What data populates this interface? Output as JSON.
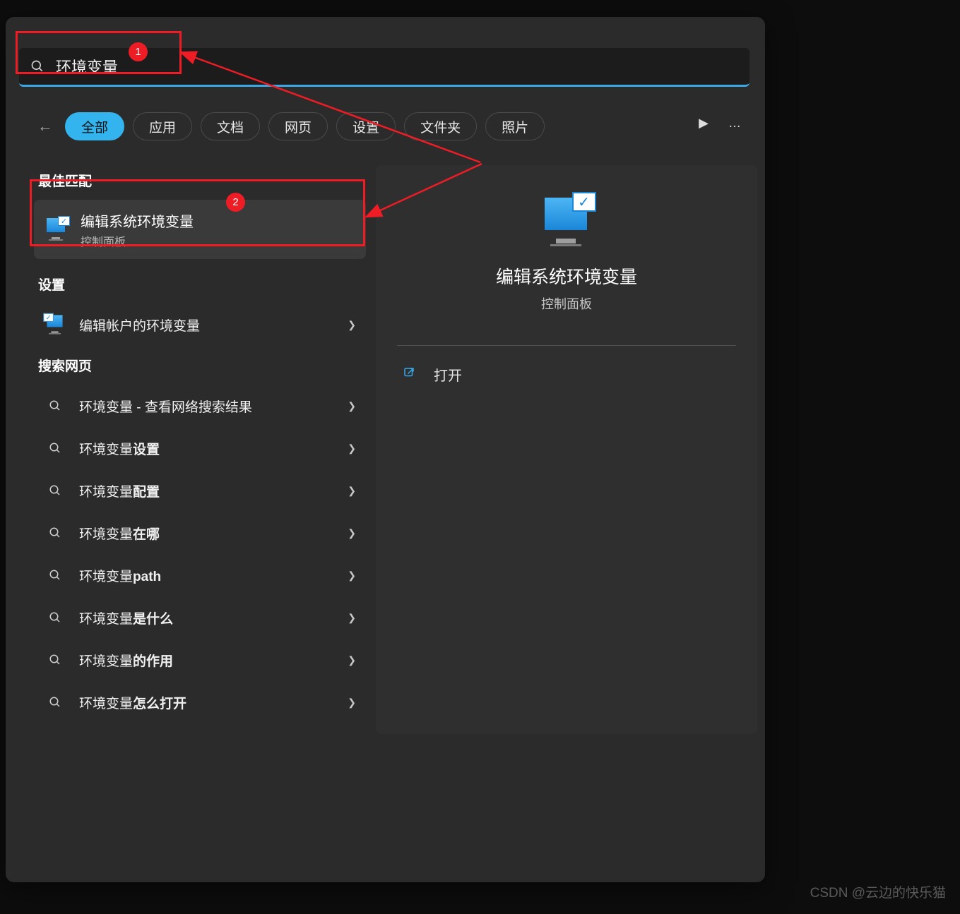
{
  "search": {
    "value": "环境变量"
  },
  "filters": [
    "全部",
    "应用",
    "文档",
    "网页",
    "设置",
    "文件夹",
    "照片"
  ],
  "active_filter": 0,
  "sections": {
    "best": "最佳匹配",
    "settings": "设置",
    "web": "搜索网页"
  },
  "best_match": {
    "title": "编辑系统环境变量",
    "subtitle": "控制面板"
  },
  "settings_items": [
    {
      "title": "编辑帐户的环境变量"
    }
  ],
  "web_items": [
    {
      "prefix": "环境变量",
      "suffix": " - 查看网络搜索结果"
    },
    {
      "prefix": "环境变量",
      "suffix": "设置"
    },
    {
      "prefix": "环境变量",
      "suffix": "配置"
    },
    {
      "prefix": "环境变量",
      "suffix": "在哪"
    },
    {
      "prefix": "环境变量",
      "suffix": "path"
    },
    {
      "prefix": "环境变量",
      "suffix": "是什么"
    },
    {
      "prefix": "环境变量",
      "suffix": "的作用"
    },
    {
      "prefix": "环境变量",
      "suffix": "怎么打开"
    }
  ],
  "preview": {
    "title": "编辑系统环境变量",
    "subtitle": "控制面板",
    "open_label": "打开"
  },
  "annotations": {
    "badge1": "1",
    "badge2": "2"
  },
  "watermark": "CSDN @云边的快乐猫"
}
